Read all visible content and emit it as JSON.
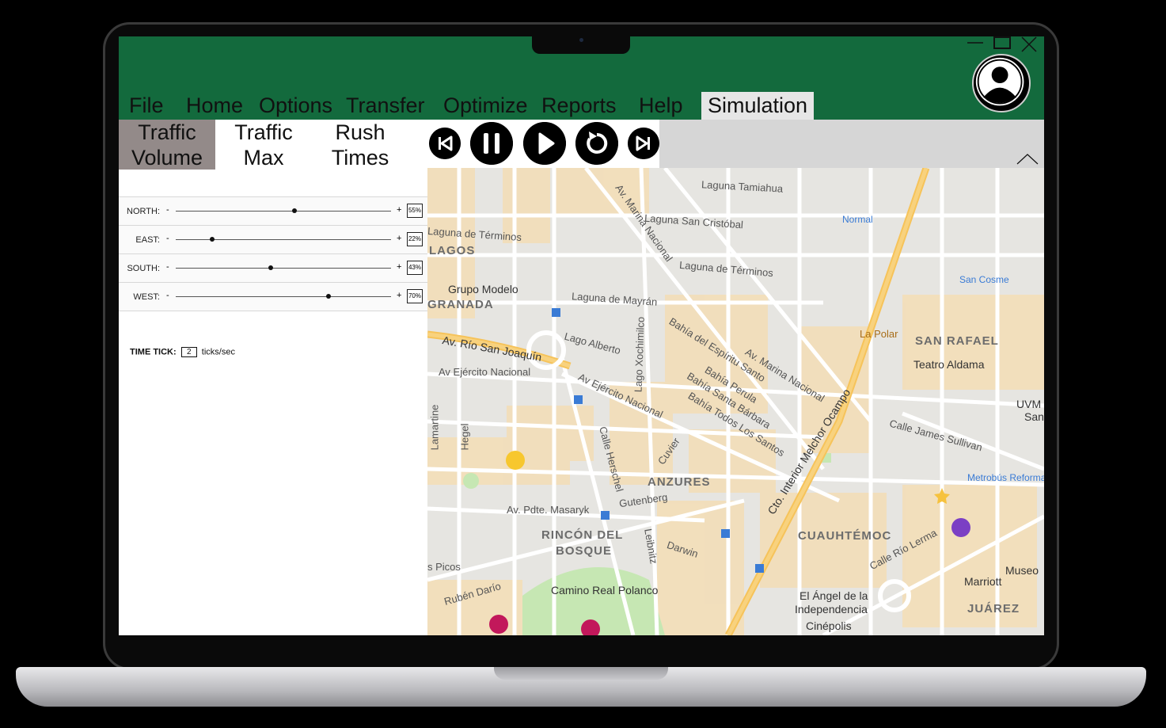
{
  "menu": {
    "items": [
      "File",
      "Home",
      "Options",
      "Transfer",
      "Optimize",
      "Reports",
      "Help"
    ],
    "active": "Simulation"
  },
  "subtabs": {
    "traffic_volume": [
      "Traffic",
      "Volume"
    ],
    "traffic_max": [
      "Traffic",
      "Max"
    ],
    "rush_times": [
      "Rush",
      "Times"
    ]
  },
  "directions": [
    {
      "label": "NORTH:",
      "minus": "-",
      "plus": "+",
      "value_text": "55%",
      "value": 0.55
    },
    {
      "label": "EAST:",
      "minus": "-",
      "plus": "+",
      "value_text": "22%",
      "value": 0.17
    },
    {
      "label": "SOUTH:",
      "minus": "-",
      "plus": "+",
      "value_text": "43%",
      "value": 0.44
    },
    {
      "label": "WEST:",
      "minus": "-",
      "plus": "+",
      "value_text": "70%",
      "value": 0.71
    }
  ],
  "time_tick": {
    "label": "TIME TICK:",
    "value": "2",
    "unit": "ticks/sec"
  },
  "playback": [
    "skip-back-icon",
    "pause-icon",
    "play-icon",
    "restart-icon",
    "skip-forward-icon"
  ],
  "colors": {
    "menubar": "#136a3d",
    "active_subtab": "#938a89",
    "toolbar": "#d6d6d6"
  },
  "map_labels": {
    "laguna_tamiahua": "Laguna Tamiahua",
    "laguna_san_cristobal": "Laguna San Cristóbal",
    "laguna_de_terminos_top": "Laguna de Términos",
    "laguna_de_terminos": "Laguna de Términos",
    "laguna_de_mayran": "Laguna de Mayrán",
    "lagos": "LAGOS",
    "granada": "GRANADA",
    "grupo_modelo": "Grupo Modelo",
    "av_rio_san_joaquin": "Av. Río San Joaquín",
    "av_ejercito_nacional": "Av Ejército Nacional",
    "av_ejercito_nacional_2": "Av Ejército Nacional",
    "lago_alberto": "Lago Alberto",
    "bahia_espiritu_santo": "Bahía del Espíritu Santo",
    "bahia_perula": "Bahía Perula",
    "bahia_santa_barbara": "Bahía Santa Bárbara",
    "bahia_todos_los_santos": "Bahía Todos Los Santos",
    "av_marina_nacional": "Av. Marina Nacional",
    "av_marina_nacional_top": "Av. Marina Nacional",
    "cto_interior": "Cto. Interior Melchor Ocampo",
    "normal": "Normal",
    "san_cosme": "San Cosme",
    "la_polar": "La Polar",
    "san_rafael": "SAN RAFAEL",
    "teatro_aldama": "Teatro Aldama",
    "uvm": "UVM",
    "san": "San",
    "calle_james_sullivan": "Calle James Sullivan",
    "metrobus_reforma": "Metrobús Reforma",
    "anzures": "ANZURES",
    "av_pdte_masaryk": "Av. Pdte. Masaryk",
    "rincon_del_bosque": "RINCÓN DEL",
    "rincon_del_bosque_2": "BOSQUE",
    "gutenberg": "Gutenberg",
    "darwin": "Darwin",
    "cuauhtemoc": "CUAUHTÉMOC",
    "calle_rio_lerma": "Calle Río Lerma",
    "museo": "Museo",
    "marriott": "Marriott",
    "angel": "El Ángel de la",
    "angel_2": "Independencia",
    "juarez": "JUÁREZ",
    "cinepolis": "Cinépolis",
    "camino_real": "Camino Real Polanco",
    "ruben_dario": "Rubén Darío",
    "picos": "s Picos",
    "hegel": "Hegel",
    "calle_herschel": "Calle Herschel",
    "cuvier": "Cuvier",
    "leibnitz": "Leibnitz",
    "lago_xochimilco": "Lago Xochimilco",
    "lamartine": "Lamartine"
  }
}
